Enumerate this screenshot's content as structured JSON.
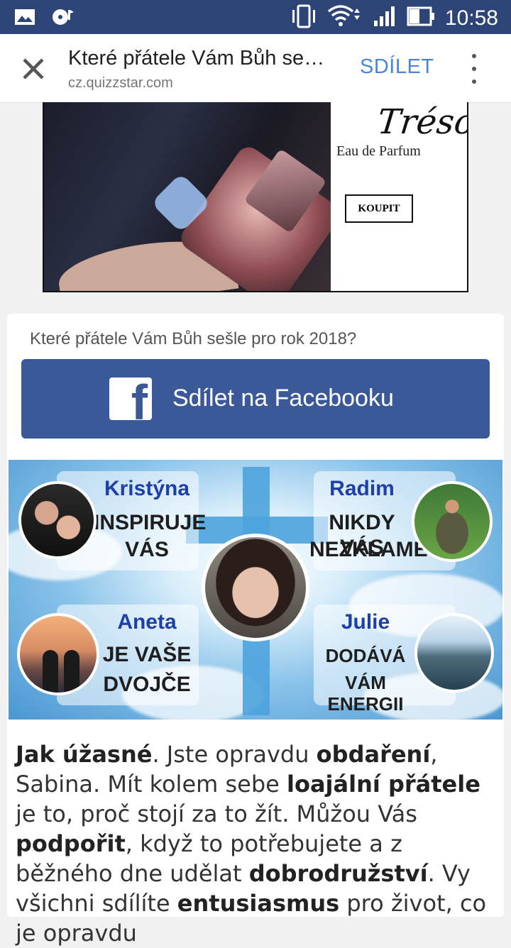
{
  "status_bar": {
    "time": "10:58",
    "icons": [
      "image-icon",
      "media-icon",
      "vibrate-icon",
      "wifi-icon",
      "signal-icon",
      "battery-icon"
    ]
  },
  "toolbar": {
    "title": "Které přátele Vám Bůh se…",
    "url": "cz.quizzstar.com",
    "share_label": "SDÍLET"
  },
  "ad": {
    "brand": "Trésor",
    "subtitle": "Eau de Parfum",
    "buy_label": "KOUPIT"
  },
  "card": {
    "question": "Které přátele Vám Bůh sešle pro rok 2018?",
    "fb_button_label": "Sdílet na Facebooku",
    "friends": [
      {
        "name": "Kristýna",
        "line1": "INSPIRUJE",
        "line2": "VÁS"
      },
      {
        "name": "Radim",
        "line1": "NIKDY VÁS",
        "line2": "NEZKLAME"
      },
      {
        "name": "Aneta",
        "line1": "JE VAŠE",
        "line2": "DVOJČE"
      },
      {
        "name": "Julie",
        "line1": "DODÁVÁ",
        "line2": "VÁM ENERGII"
      }
    ]
  },
  "body": {
    "p1": "Jak úžasné",
    "p2": ". Jste opravdu ",
    "p3": "obdaření",
    "p4": ", Sabina. Mít kolem sebe ",
    "p5": "loajální přátele",
    "p6": " je to, proč stojí za to žít. Můžou Vás ",
    "p7": "podpořit",
    "p8": ", když to potřebujete a z běžného dne udělat ",
    "p9": "dobrodružství",
    "p10": ". Vy všichni sdílíte ",
    "p11": "entusiasmus",
    "p12": " pro život, co je opravdu"
  },
  "colors": {
    "status_bar": "#2d4477",
    "facebook": "#3b5998",
    "share_link": "#4a86d8",
    "friend_name": "#1f3fa8"
  }
}
